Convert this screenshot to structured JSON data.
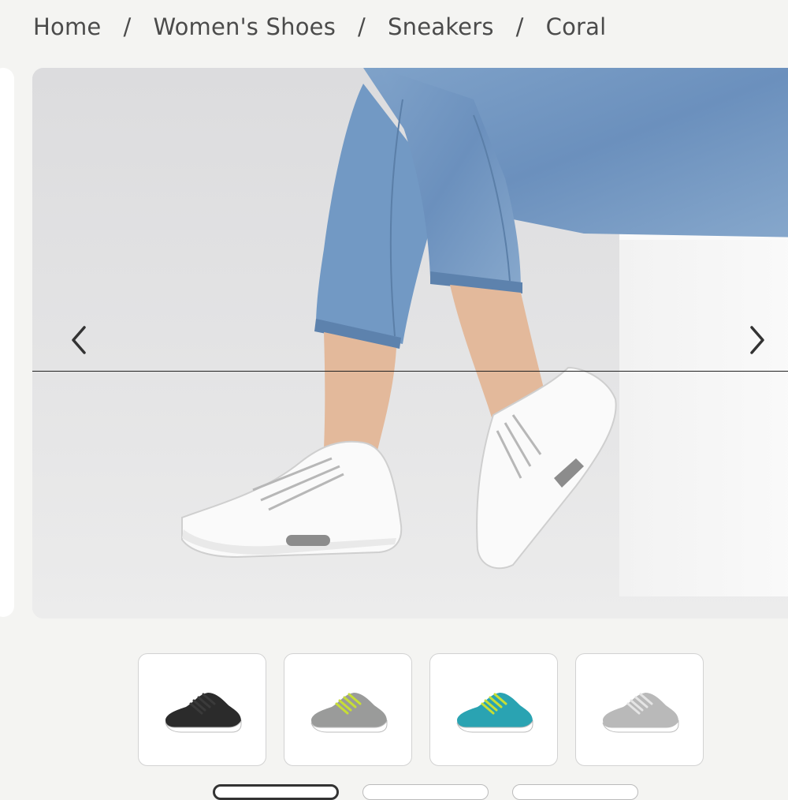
{
  "breadcrumb": {
    "items": [
      {
        "label": "Home"
      },
      {
        "label": "Women's Shoes"
      },
      {
        "label": "Sneakers"
      },
      {
        "label": "Coral"
      }
    ],
    "separator": "/"
  },
  "gallery": {
    "main_image_alt": "woman in cropped jeans wearing white sneakers",
    "prev_icon": "chevron-left-icon",
    "next_icon": "chevron-right-icon"
  },
  "thumbnails": [
    {
      "color_name": "black",
      "shoe_color": "#2b2b2b",
      "lace_color": "#3a3a3a",
      "sole_color": "#ffffff"
    },
    {
      "color_name": "grey-lime",
      "shoe_color": "#9a9b9a",
      "lace_color": "#c7de34",
      "sole_color": "#ffffff"
    },
    {
      "color_name": "turquoise",
      "shoe_color": "#2aa3b2",
      "lace_color": "#c7de34",
      "sole_color": "#ffffff"
    },
    {
      "color_name": "light-grey",
      "shoe_color": "#b9b9b9",
      "lace_color": "#e4e4e4",
      "sole_color": "#ffffff"
    }
  ]
}
